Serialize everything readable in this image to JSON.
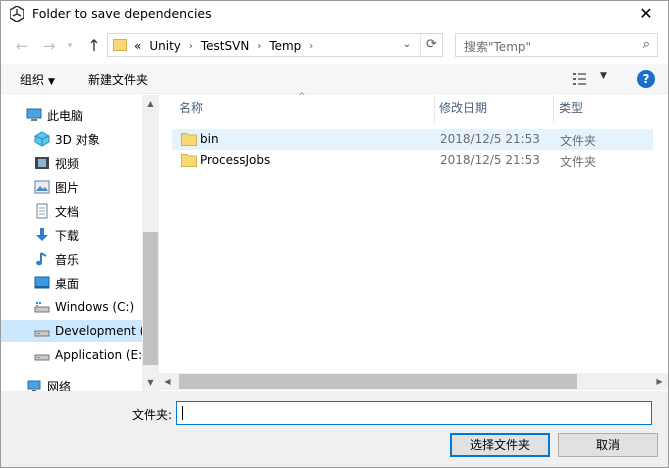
{
  "window": {
    "title": "Folder to save dependencies",
    "close_glyph": "✕"
  },
  "address": {
    "overflow": "«",
    "crumbs": [
      "Unity",
      "TestSVN",
      "Temp"
    ],
    "separator": "›",
    "search_placeholder": "搜索\"Temp\""
  },
  "toolbar": {
    "organize": "组织",
    "new_folder": "新建文件夹"
  },
  "nav": {
    "items": [
      {
        "label": "此电脑",
        "icon": "computer-icon"
      },
      {
        "label": "3D 对象",
        "icon": "3d-objects-icon"
      },
      {
        "label": "视频",
        "icon": "video-icon"
      },
      {
        "label": "图片",
        "icon": "pictures-icon"
      },
      {
        "label": "文档",
        "icon": "documents-icon"
      },
      {
        "label": "下载",
        "icon": "download-icon"
      },
      {
        "label": "音乐",
        "icon": "music-icon"
      },
      {
        "label": "桌面",
        "icon": "desktop-icon"
      },
      {
        "label": "Windows (C:)",
        "icon": "drive-icon"
      },
      {
        "label": "Development (",
        "icon": "drive-icon"
      },
      {
        "label": "Application (E:)",
        "icon": "drive-icon"
      },
      {
        "label": "网络",
        "icon": "network-icon"
      }
    ],
    "selected_index": 9
  },
  "columns": {
    "name": "名称",
    "date": "修改日期",
    "type": "类型"
  },
  "files": [
    {
      "name": "bin",
      "date": "2018/12/5 21:53",
      "type": "文件夹"
    },
    {
      "name": "ProcessJobs",
      "date": "2018/12/5 21:53",
      "type": "文件夹"
    }
  ],
  "footer": {
    "folder_label": "文件夹:",
    "folder_value": "",
    "select_button": "选择文件夹",
    "cancel_button": "取消"
  },
  "colors": {
    "accent": "#0078d7",
    "folder": "#f8d775",
    "selection": "#cce8ff",
    "hover": "#e5f3ff"
  }
}
